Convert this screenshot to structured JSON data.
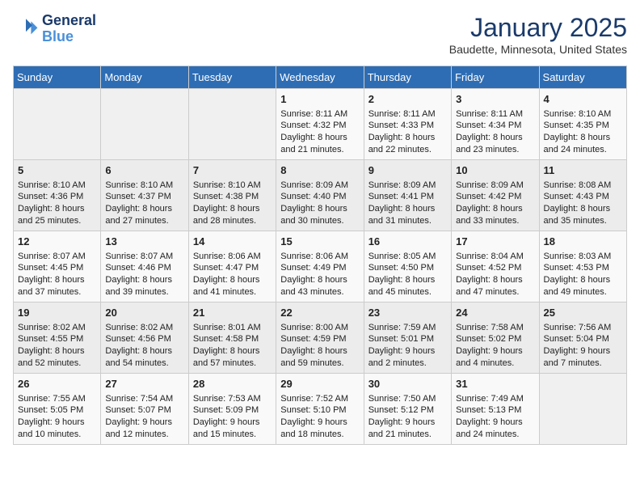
{
  "header": {
    "logo_line1": "General",
    "logo_line2": "Blue",
    "month": "January 2025",
    "location": "Baudette, Minnesota, United States"
  },
  "days_of_week": [
    "Sunday",
    "Monday",
    "Tuesday",
    "Wednesday",
    "Thursday",
    "Friday",
    "Saturday"
  ],
  "weeks": [
    [
      {
        "day": "",
        "info": ""
      },
      {
        "day": "",
        "info": ""
      },
      {
        "day": "",
        "info": ""
      },
      {
        "day": "1",
        "info": "Sunrise: 8:11 AM\nSunset: 4:32 PM\nDaylight: 8 hours and 21 minutes."
      },
      {
        "day": "2",
        "info": "Sunrise: 8:11 AM\nSunset: 4:33 PM\nDaylight: 8 hours and 22 minutes."
      },
      {
        "day": "3",
        "info": "Sunrise: 8:11 AM\nSunset: 4:34 PM\nDaylight: 8 hours and 23 minutes."
      },
      {
        "day": "4",
        "info": "Sunrise: 8:10 AM\nSunset: 4:35 PM\nDaylight: 8 hours and 24 minutes."
      }
    ],
    [
      {
        "day": "5",
        "info": "Sunrise: 8:10 AM\nSunset: 4:36 PM\nDaylight: 8 hours and 25 minutes."
      },
      {
        "day": "6",
        "info": "Sunrise: 8:10 AM\nSunset: 4:37 PM\nDaylight: 8 hours and 27 minutes."
      },
      {
        "day": "7",
        "info": "Sunrise: 8:10 AM\nSunset: 4:38 PM\nDaylight: 8 hours and 28 minutes."
      },
      {
        "day": "8",
        "info": "Sunrise: 8:09 AM\nSunset: 4:40 PM\nDaylight: 8 hours and 30 minutes."
      },
      {
        "day": "9",
        "info": "Sunrise: 8:09 AM\nSunset: 4:41 PM\nDaylight: 8 hours and 31 minutes."
      },
      {
        "day": "10",
        "info": "Sunrise: 8:09 AM\nSunset: 4:42 PM\nDaylight: 8 hours and 33 minutes."
      },
      {
        "day": "11",
        "info": "Sunrise: 8:08 AM\nSunset: 4:43 PM\nDaylight: 8 hours and 35 minutes."
      }
    ],
    [
      {
        "day": "12",
        "info": "Sunrise: 8:07 AM\nSunset: 4:45 PM\nDaylight: 8 hours and 37 minutes."
      },
      {
        "day": "13",
        "info": "Sunrise: 8:07 AM\nSunset: 4:46 PM\nDaylight: 8 hours and 39 minutes."
      },
      {
        "day": "14",
        "info": "Sunrise: 8:06 AM\nSunset: 4:47 PM\nDaylight: 8 hours and 41 minutes."
      },
      {
        "day": "15",
        "info": "Sunrise: 8:06 AM\nSunset: 4:49 PM\nDaylight: 8 hours and 43 minutes."
      },
      {
        "day": "16",
        "info": "Sunrise: 8:05 AM\nSunset: 4:50 PM\nDaylight: 8 hours and 45 minutes."
      },
      {
        "day": "17",
        "info": "Sunrise: 8:04 AM\nSunset: 4:52 PM\nDaylight: 8 hours and 47 minutes."
      },
      {
        "day": "18",
        "info": "Sunrise: 8:03 AM\nSunset: 4:53 PM\nDaylight: 8 hours and 49 minutes."
      }
    ],
    [
      {
        "day": "19",
        "info": "Sunrise: 8:02 AM\nSunset: 4:55 PM\nDaylight: 8 hours and 52 minutes."
      },
      {
        "day": "20",
        "info": "Sunrise: 8:02 AM\nSunset: 4:56 PM\nDaylight: 8 hours and 54 minutes."
      },
      {
        "day": "21",
        "info": "Sunrise: 8:01 AM\nSunset: 4:58 PM\nDaylight: 8 hours and 57 minutes."
      },
      {
        "day": "22",
        "info": "Sunrise: 8:00 AM\nSunset: 4:59 PM\nDaylight: 8 hours and 59 minutes."
      },
      {
        "day": "23",
        "info": "Sunrise: 7:59 AM\nSunset: 5:01 PM\nDaylight: 9 hours and 2 minutes."
      },
      {
        "day": "24",
        "info": "Sunrise: 7:58 AM\nSunset: 5:02 PM\nDaylight: 9 hours and 4 minutes."
      },
      {
        "day": "25",
        "info": "Sunrise: 7:56 AM\nSunset: 5:04 PM\nDaylight: 9 hours and 7 minutes."
      }
    ],
    [
      {
        "day": "26",
        "info": "Sunrise: 7:55 AM\nSunset: 5:05 PM\nDaylight: 9 hours and 10 minutes."
      },
      {
        "day": "27",
        "info": "Sunrise: 7:54 AM\nSunset: 5:07 PM\nDaylight: 9 hours and 12 minutes."
      },
      {
        "day": "28",
        "info": "Sunrise: 7:53 AM\nSunset: 5:09 PM\nDaylight: 9 hours and 15 minutes."
      },
      {
        "day": "29",
        "info": "Sunrise: 7:52 AM\nSunset: 5:10 PM\nDaylight: 9 hours and 18 minutes."
      },
      {
        "day": "30",
        "info": "Sunrise: 7:50 AM\nSunset: 5:12 PM\nDaylight: 9 hours and 21 minutes."
      },
      {
        "day": "31",
        "info": "Sunrise: 7:49 AM\nSunset: 5:13 PM\nDaylight: 9 hours and 24 minutes."
      },
      {
        "day": "",
        "info": ""
      }
    ]
  ]
}
